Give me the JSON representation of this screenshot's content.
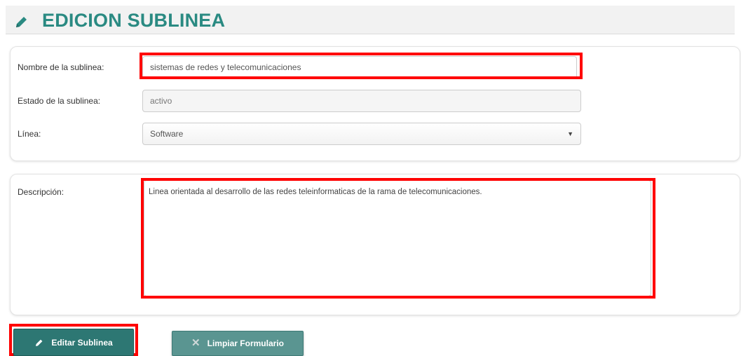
{
  "header": {
    "title": "EDICION SUBLINEA",
    "icon": "pencil-icon",
    "color": "#2a8a82"
  },
  "form": {
    "nombre_label": "Nombre de la sublinea:",
    "nombre_value": "sistemas de redes y telecomunicaciones",
    "estado_label": "Estado de la sublinea:",
    "estado_value": "activo",
    "linea_label": "Línea:",
    "linea_value": "Software",
    "descripcion_label": "Descripción:",
    "descripcion_value": "Linea orientada al desarrollo de las redes teleinformaticas de la rama de telecomunicaciones."
  },
  "buttons": {
    "edit_label": "Editar Sublinea",
    "clear_label": "Limpiar Formulario"
  },
  "colors": {
    "button_primary": "#2d7773",
    "highlight": "#ff0000"
  }
}
